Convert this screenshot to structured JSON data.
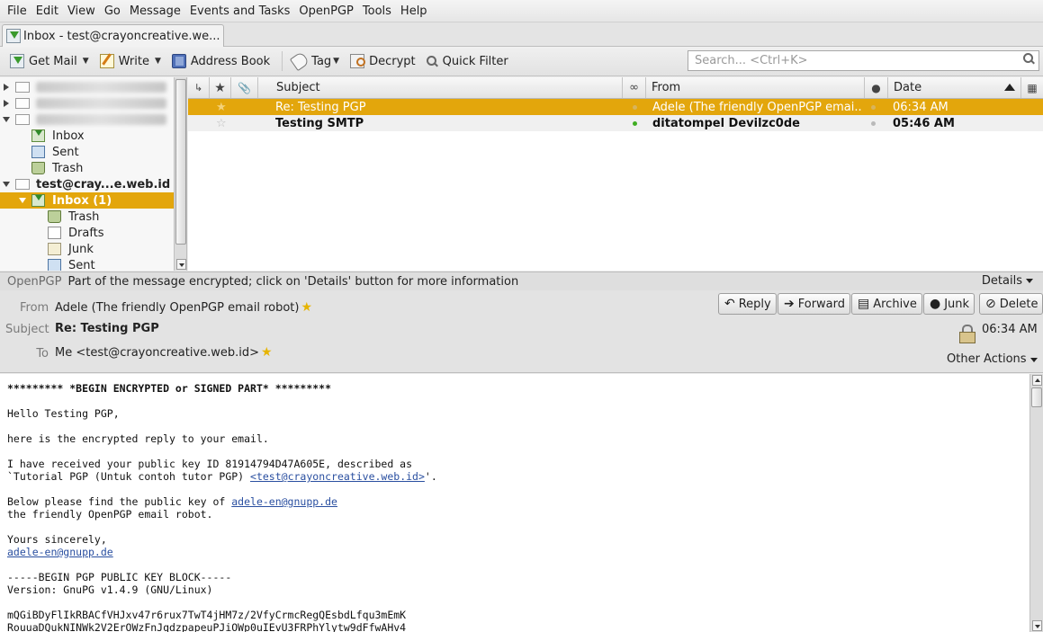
{
  "menu": [
    "File",
    "Edit",
    "View",
    "Go",
    "Message",
    "Events and Tasks",
    "OpenPGP",
    "Tools",
    "Help"
  ],
  "tab": {
    "title": "Inbox - test@crayoncreative.we..."
  },
  "toolbar": {
    "get_mail": "Get Mail",
    "write": "Write",
    "address_book": "Address Book",
    "tag": "Tag",
    "decrypt": "Decrypt",
    "quick_filter": "Quick Filter",
    "search_placeholder": "Search... <Ctrl+K>"
  },
  "folders": {
    "inbox1": "Inbox",
    "sent1": "Sent",
    "trash1": "Trash",
    "account": "test@cray...e.web.id",
    "inbox2": "Inbox (1)",
    "trash2": "Trash",
    "drafts": "Drafts",
    "junk": "Junk",
    "sent2": "Sent"
  },
  "columns": {
    "subject": "Subject",
    "from": "From",
    "date": "Date"
  },
  "messages": [
    {
      "subject": "Re: Testing PGP",
      "from": "Adele (The friendly OpenPGP emai...",
      "date": "06:34 AM",
      "selected": true
    },
    {
      "subject": "Testing SMTP",
      "from": "ditatompel Devilzc0de",
      "date": "05:46 AM",
      "unread": true
    }
  ],
  "pgp": {
    "tag": "OpenPGP",
    "notice": "Part of the message encrypted; click on 'Details' button for more information",
    "details": "Details"
  },
  "header": {
    "from_label": "From",
    "from_value": "Adele (The friendly OpenPGP email robot)",
    "subject_label": "Subject",
    "subject_value": "Re: Testing PGP",
    "to_label": "To",
    "to_value": "Me <test@crayoncreative.web.id>",
    "time": "06:34 AM",
    "other_actions": "Other Actions",
    "reply": "Reply",
    "forward": "Forward",
    "archive": "Archive",
    "junk": "Junk",
    "delete": "Delete"
  },
  "body": {
    "l1": "********* *BEGIN ENCRYPTED or SIGNED PART* *********",
    "l2": "Hello Testing PGP,",
    "l3": "here is the encrypted reply to your email.",
    "l4": "I have received your public key ID 81914794D47A605E, described as",
    "l5a": "`Tutorial PGP (Untuk contoh tutor PGP) ",
    "l5link": "<test@crayoncreative.web.id>",
    "l5b": "'.",
    "l6a": "Below please find the public key of ",
    "l6link": "adele-en@gnupp.de",
    "l7": "the friendly OpenPGP email robot.",
    "l8": "Yours sincerely,",
    "l9link": "adele-en@gnupp.de",
    "l10": "-----BEGIN PGP PUBLIC KEY BLOCK-----",
    "l11": "Version: GnuPG v1.4.9 (GNU/Linux)",
    "l12": "mQGiBDyFlIkRBACfVHJxv47r6rux7TwT4jHM7z/2VfyCrmcRegQEsbdLfqu3mEmK",
    "l13": "RouuaDQukNINWk2V2ErOWzFnJqdzpapeuPJiOWp0uIEvU3FRPhYlytw9dFfwAHv4"
  }
}
